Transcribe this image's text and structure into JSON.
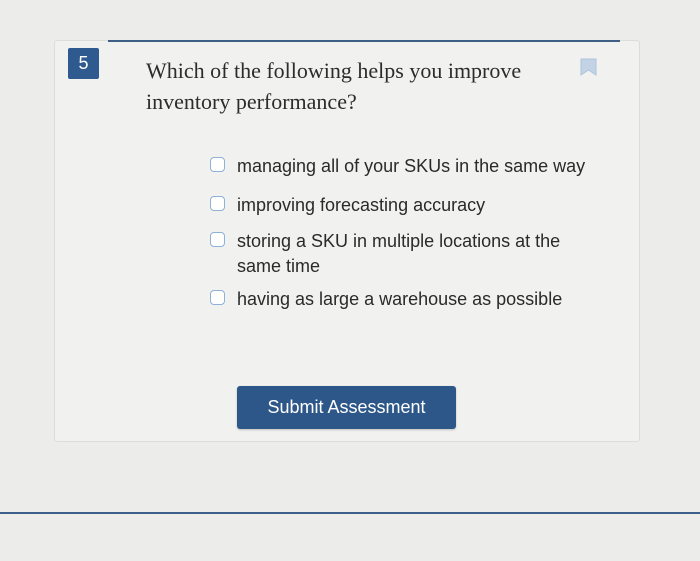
{
  "question": {
    "number": "5",
    "text": "Which of the following helps you improve inventory performance?",
    "bookmark_icon": "bookmark-icon"
  },
  "options": [
    {
      "label": "managing all of your SKUs in the same way",
      "checked": false
    },
    {
      "label": "improving forecasting accuracy",
      "checked": false
    },
    {
      "label": "storing a SKU in multiple locations at the same time",
      "checked": false
    },
    {
      "label": "having as large a warehouse as possible",
      "checked": false
    }
  ],
  "submit": {
    "label": "Submit Assessment"
  },
  "colors": {
    "accent": "#2f5a8f",
    "checkbox_border": "#8db1d9",
    "background": "#ececea"
  }
}
